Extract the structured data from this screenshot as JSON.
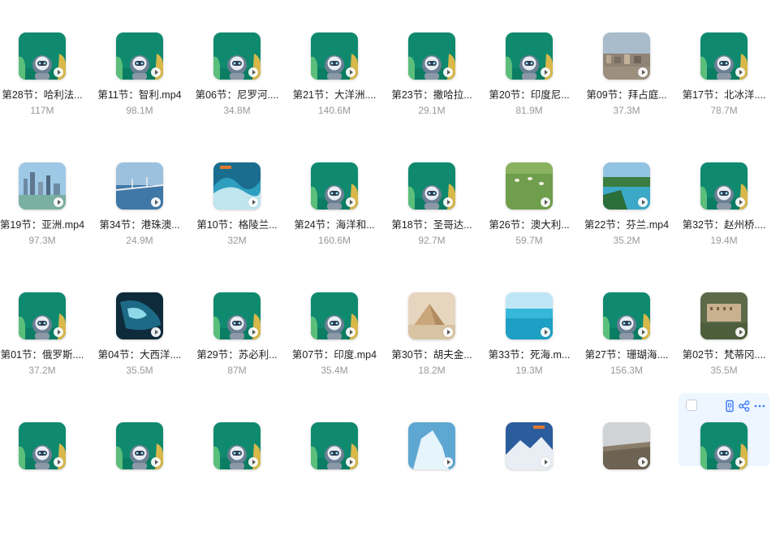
{
  "accent_color": "#3a7afe",
  "files": [
    {
      "name": "第28节：哈利法...",
      "size": "117M",
      "thumb": "avatar-icon"
    },
    {
      "name": "第11节：智利.mp4",
      "size": "98.1M",
      "thumb": "avatar-icon"
    },
    {
      "name": "第06节：尼罗河....",
      "size": "34.8M",
      "thumb": "avatar-icon"
    },
    {
      "name": "第21节：大洋洲....",
      "size": "140.6M",
      "thumb": "avatar-icon"
    },
    {
      "name": "第23节：撒哈拉...",
      "size": "29.1M",
      "thumb": "avatar-icon"
    },
    {
      "name": "第20节：印度尼...",
      "size": "81.9M",
      "thumb": "avatar-icon"
    },
    {
      "name": "第09节：拜占庭...",
      "size": "37.3M",
      "thumb": "city-photo"
    },
    {
      "name": "第17节：北冰洋....",
      "size": "78.7M",
      "thumb": "avatar-icon"
    },
    {
      "name": "第19节：亚洲.mp4",
      "size": "97.3M",
      "thumb": "skyline-photo"
    },
    {
      "name": "第34节：港珠澳...",
      "size": "24.9M",
      "thumb": "bridge-photo"
    },
    {
      "name": "第10节：格陵兰...",
      "size": "32M",
      "thumb": "wave-photo"
    },
    {
      "name": "第24节：海洋和...",
      "size": "160.6M",
      "thumb": "avatar-icon"
    },
    {
      "name": "第18节：圣哥达...",
      "size": "92.7M",
      "thumb": "avatar-icon"
    },
    {
      "name": "第26节：澳大利...",
      "size": "59.7M",
      "thumb": "grassland-photo"
    },
    {
      "name": "第22节：芬兰.mp4",
      "size": "35.2M",
      "thumb": "lake-photo"
    },
    {
      "name": "第32节：赵州桥....",
      "size": "19.4M",
      "thumb": "avatar-icon"
    },
    {
      "name": "第01节：俄罗斯....",
      "size": "37.2M",
      "thumb": "avatar-icon"
    },
    {
      "name": "第04节：大西洋....",
      "size": "35.5M",
      "thumb": "ocean-satellite-photo"
    },
    {
      "name": "第29节：苏必利...",
      "size": "87M",
      "thumb": "avatar-icon"
    },
    {
      "name": "第07节：印度.mp4",
      "size": "35.4M",
      "thumb": "avatar-icon"
    },
    {
      "name": "第30节：胡夫金...",
      "size": "18.2M",
      "thumb": "pyramid-photo"
    },
    {
      "name": "第33节：死海.m...",
      "size": "19.3M",
      "thumb": "sea-photo"
    },
    {
      "name": "第27节：珊瑚海....",
      "size": "156.3M",
      "thumb": "avatar-icon"
    },
    {
      "name": "第02节：梵蒂冈....",
      "size": "35.5M",
      "thumb": "building-photo"
    },
    {
      "name": "",
      "size": "",
      "thumb": "avatar-icon"
    },
    {
      "name": "",
      "size": "",
      "thumb": "avatar-icon"
    },
    {
      "name": "",
      "size": "",
      "thumb": "avatar-icon"
    },
    {
      "name": "",
      "size": "",
      "thumb": "avatar-icon"
    },
    {
      "name": "",
      "size": "",
      "thumb": "iceberg-photo"
    },
    {
      "name": "",
      "size": "",
      "thumb": "mountain-photo"
    },
    {
      "name": "",
      "size": "",
      "thumb": "valley-photo"
    },
    {
      "name": "",
      "size": "",
      "thumb": "avatar-icon"
    }
  ],
  "hover_actions": {
    "checkbox": "checkbox",
    "phone": "phone-icon",
    "share": "share-icon",
    "more": "more-icon"
  }
}
